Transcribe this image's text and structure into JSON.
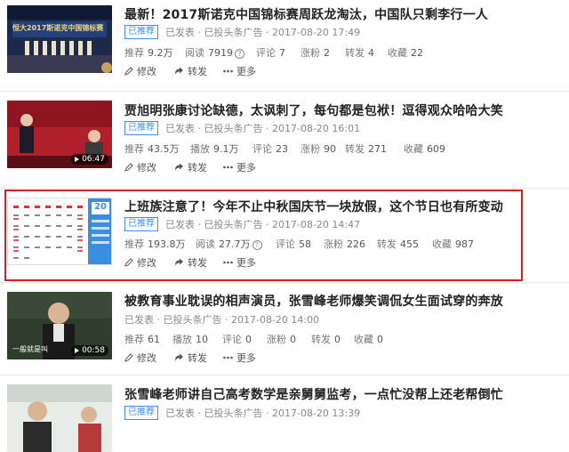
{
  "articles": [
    {
      "title": "最新！2017斯诺克中国锦标赛周跃龙淘汰，中国队只剩李行一人",
      "badge": "已推荐",
      "status": "已发表 · 已投头条广告 · 2017-08-20 17:49",
      "stats": [
        {
          "label": "推荐",
          "value": "9.2万"
        },
        {
          "label": "阅读",
          "value": "7919"
        },
        {
          "label": "评论",
          "value": "7"
        },
        {
          "label": "涨粉",
          "value": "2"
        },
        {
          "label": "转发",
          "value": "4"
        },
        {
          "label": "收藏",
          "value": "22"
        }
      ],
      "thumb_text": "恒大2017斯诺克中国锦标赛",
      "duration": ""
    },
    {
      "title": "贾旭明张康讨论缺德，太讽刺了，每句都是包袱！逗得观众哈哈大笑",
      "badge": "已推荐",
      "status": "已发表 · 已投头条广告 · 2017-08-20 16:01",
      "stats": [
        {
          "label": "推荐",
          "value": "43.5万"
        },
        {
          "label": "播放",
          "value": "9.1万"
        },
        {
          "label": "评论",
          "value": "23"
        },
        {
          "label": "涨粉",
          "value": "90"
        },
        {
          "label": "转发",
          "value": "271"
        },
        {
          "label": "收藏",
          "value": "609"
        }
      ],
      "duration": "06:47"
    },
    {
      "title": "上班族注意了！今年不止中秋国庆节一块放假，这个节日也有所变动",
      "badge": "已推荐",
      "status": "已发表 · 已投头条广告 · 2017-08-20 14:47",
      "stats": [
        {
          "label": "推荐",
          "value": "193.8万"
        },
        {
          "label": "阅读",
          "value": "27.7万"
        },
        {
          "label": "评论",
          "value": "58"
        },
        {
          "label": "涨粉",
          "value": "226"
        },
        {
          "label": "转发",
          "value": "455"
        },
        {
          "label": "收藏",
          "value": "987"
        }
      ],
      "calendar_day": "20",
      "duration": ""
    },
    {
      "title": "被教育事业耽误的相声演员，张雪峰老师爆笑调侃女生面试穿的奔放",
      "badge": "",
      "status": "已发表 · 已投头条广告 · 2017-08-20 14:00",
      "stats": [
        {
          "label": "推荐",
          "value": "61"
        },
        {
          "label": "播放",
          "value": "10"
        },
        {
          "label": "评论",
          "value": "0"
        },
        {
          "label": "涨粉",
          "value": "0"
        },
        {
          "label": "转发",
          "value": "0"
        },
        {
          "label": "收藏",
          "value": "0"
        }
      ],
      "thumb_text": "一般就是叫",
      "duration": "00:58"
    },
    {
      "title": "张雪峰老师讲自己高考数学是亲舅舅监考，一点忙没帮上还老帮倒忙",
      "badge": "已推荐",
      "status": "已发表 · 已投头条广告 · 2017-08-20 13:39",
      "stats": [],
      "duration": ""
    }
  ],
  "actions": {
    "edit": "修改",
    "share": "转发",
    "more": "更多"
  },
  "colors": {
    "badge": "#3e8ef7",
    "highlight": "#d42020",
    "title": "#222222",
    "meta": "#888888"
  }
}
